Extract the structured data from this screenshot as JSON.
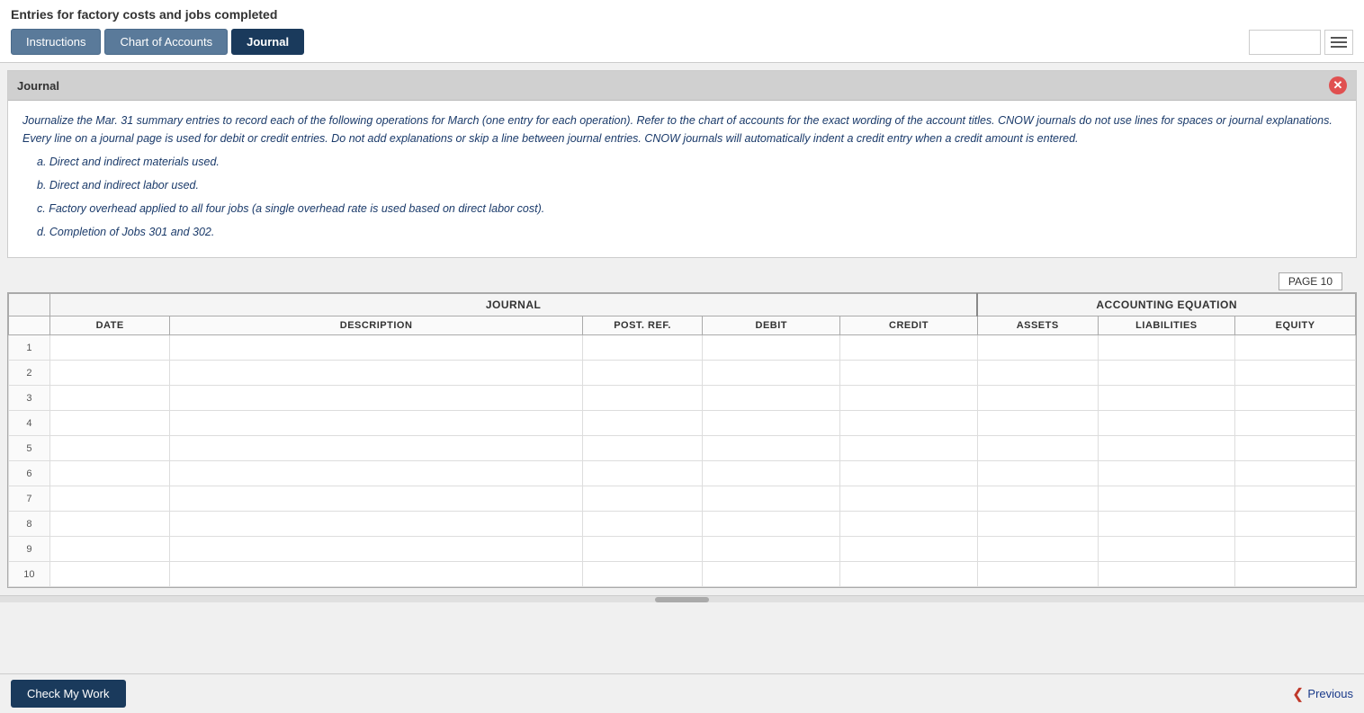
{
  "page": {
    "title": "Entries for factory costs and jobs completed"
  },
  "tabs": [
    {
      "id": "instructions",
      "label": "Instructions",
      "active": false
    },
    {
      "id": "chart-of-accounts",
      "label": "Chart of Accounts",
      "active": false
    },
    {
      "id": "journal",
      "label": "Journal",
      "active": true
    }
  ],
  "journal_panel": {
    "title": "Journal",
    "instructions_text_1": "Journalize the Mar. 31 summary entries to record each of the following operations for March (one entry for each operation). Refer to the chart of accounts for the exact wording of the account titles. CNOW journals do not use lines for spaces or journal explanations. Every line on a journal page is used for debit or credit entries. Do not add explanations or skip a line between journal entries. CNOW journals will automatically indent a credit entry when a credit amount is entered.",
    "items": [
      "a.  Direct and indirect materials used.",
      "b.  Direct and indirect labor used.",
      "c.  Factory overhead applied to all four jobs (a single overhead rate is used based on direct labor cost).",
      "d.  Completion of Jobs 301 and 302."
    ]
  },
  "journal_table": {
    "page_label": "PAGE 10",
    "sections": [
      {
        "label": "JOURNAL",
        "colspan": 6
      },
      {
        "label": "ACCOUNTING EQUATION",
        "colspan": 3
      }
    ],
    "columns": [
      {
        "id": "row-num",
        "label": ""
      },
      {
        "id": "date",
        "label": "DATE"
      },
      {
        "id": "description",
        "label": "DESCRIPTION"
      },
      {
        "id": "post-ref",
        "label": "POST. REF."
      },
      {
        "id": "debit",
        "label": "DEBIT"
      },
      {
        "id": "credit",
        "label": "CREDIT"
      },
      {
        "id": "assets",
        "label": "ASSETS"
      },
      {
        "id": "liabilities",
        "label": "LIABILITIES"
      },
      {
        "id": "equity",
        "label": "EQUITY"
      }
    ],
    "rows": [
      1,
      2,
      3,
      4,
      5,
      6,
      7,
      8,
      9,
      10
    ]
  },
  "buttons": {
    "check_my_work": "Check My Work",
    "previous": "Previous"
  }
}
